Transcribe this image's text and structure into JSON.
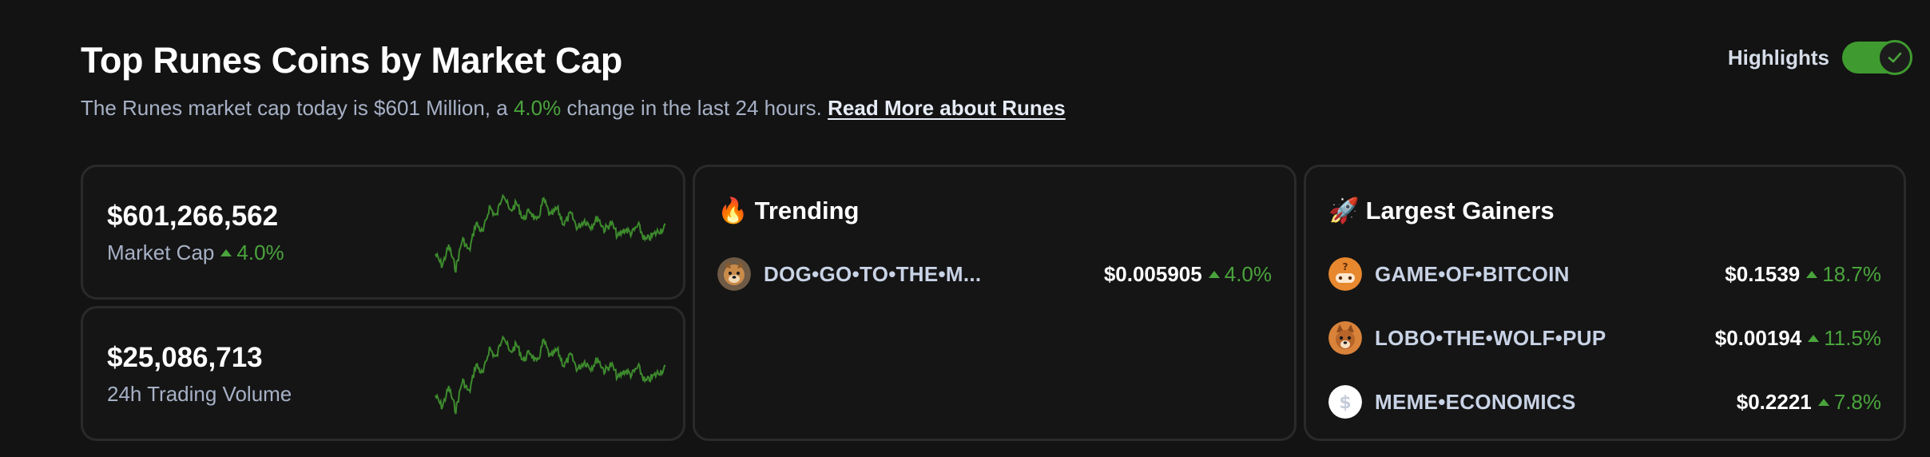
{
  "header": {
    "title": "Top Runes Coins by Market Cap",
    "subtitle_prefix": "The Runes market cap today is $601 Million, a",
    "subtitle_change": "4.0%",
    "subtitle_suffix": "change in the last 24 hours.",
    "read_more": "Read More about Runes"
  },
  "highlights": {
    "label": "Highlights",
    "enabled": true
  },
  "stats": [
    {
      "value": "$601,266,562",
      "label": "Market Cap",
      "change": "4.0%"
    },
    {
      "value": "$25,086,713",
      "label": "24h Trading Volume"
    }
  ],
  "trending": {
    "emoji": "🔥",
    "title": "Trending",
    "items": [
      {
        "name": "DOG•GO•TO•THE•M...",
        "price": "$0.005905",
        "change": "4.0%",
        "icon": "dog-icon"
      }
    ]
  },
  "gainers": {
    "emoji": "🚀",
    "title": "Largest Gainers",
    "items": [
      {
        "name": "GAME•OF•BITCOIN",
        "price": "$0.1539",
        "change": "18.7%",
        "icon": "game-controller-icon"
      },
      {
        "name": "LOBO•THE•WOLF•PUP",
        "price": "$0.00194",
        "change": "11.5%",
        "icon": "wolf-icon"
      },
      {
        "name": "MEME•ECONOMICS",
        "price": "$0.2221",
        "change": "7.8%",
        "icon": "dollar-icon"
      }
    ]
  },
  "colors": {
    "background": "#131313",
    "card_border": "#2a2a2a",
    "positive": "#4aa43c",
    "muted_text": "#a7b1c6"
  }
}
